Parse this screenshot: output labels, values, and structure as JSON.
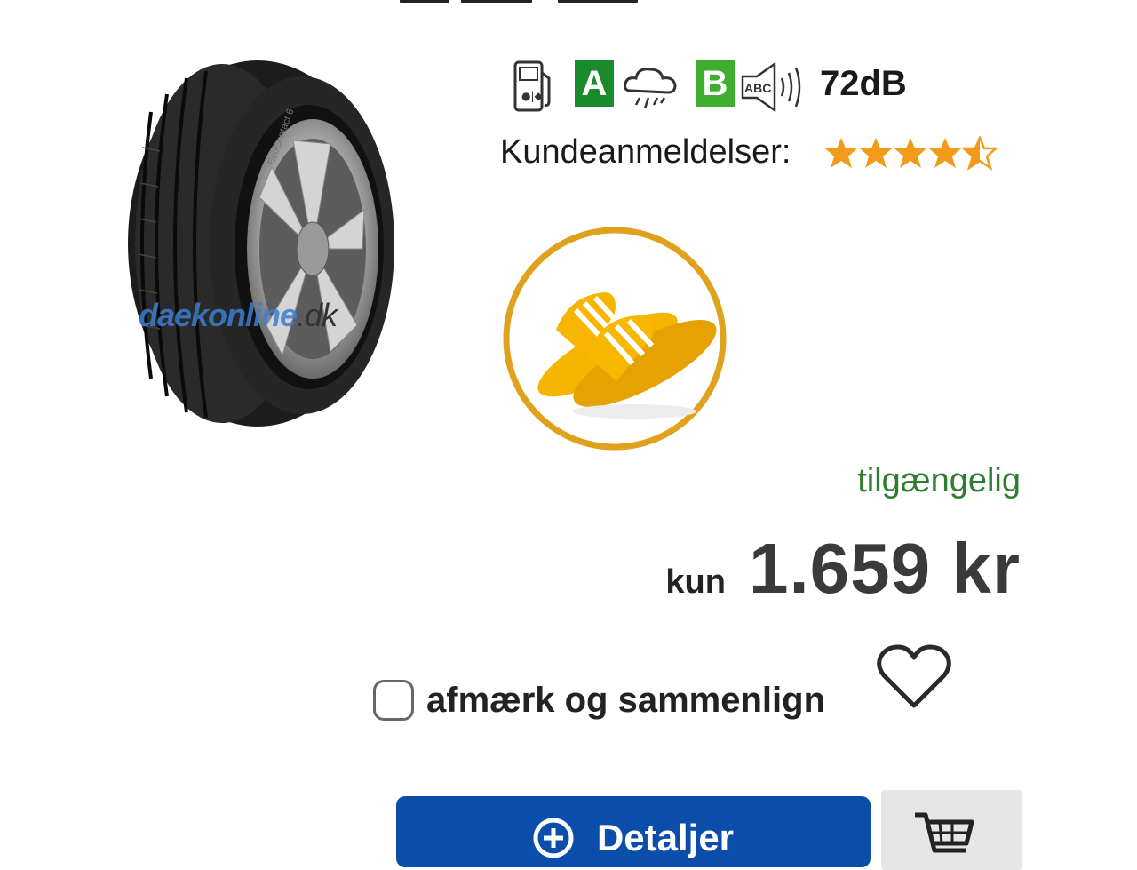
{
  "product": {
    "image_watermark": {
      "main": "daekonline",
      "tld": ".dk"
    }
  },
  "eu_label": {
    "fuel_icon": "fuel-pump-icon",
    "fuel_grade": "A",
    "wet_icon": "rain-cloud-icon",
    "wet_grade": "B",
    "noise_icon": "noise-speaker-icon",
    "noise_value": "72dB",
    "colors": {
      "grade_a": "#1a8a2a",
      "grade_b": "#3fae2f"
    }
  },
  "reviews": {
    "label": "Kundeanmeldelser:",
    "rating": 4.5,
    "max": 5,
    "star_color": "#f29a1a"
  },
  "promo": {
    "icon": "yellow-slippers-icon",
    "ring_color": "#e0a21c"
  },
  "availability": {
    "text": "tilgængelig",
    "color": "#2e7d32"
  },
  "price": {
    "prefix": "kun",
    "value": "1.659 kr"
  },
  "compare": {
    "label": "afmærk og sammenlign",
    "checked": false
  },
  "wishlist": {
    "icon": "heart-icon"
  },
  "actions": {
    "details_label": "Detaljer",
    "details_icon": "plus-circle-icon",
    "details_color": "#0b4dab",
    "cart_icon": "shopping-cart-icon"
  }
}
